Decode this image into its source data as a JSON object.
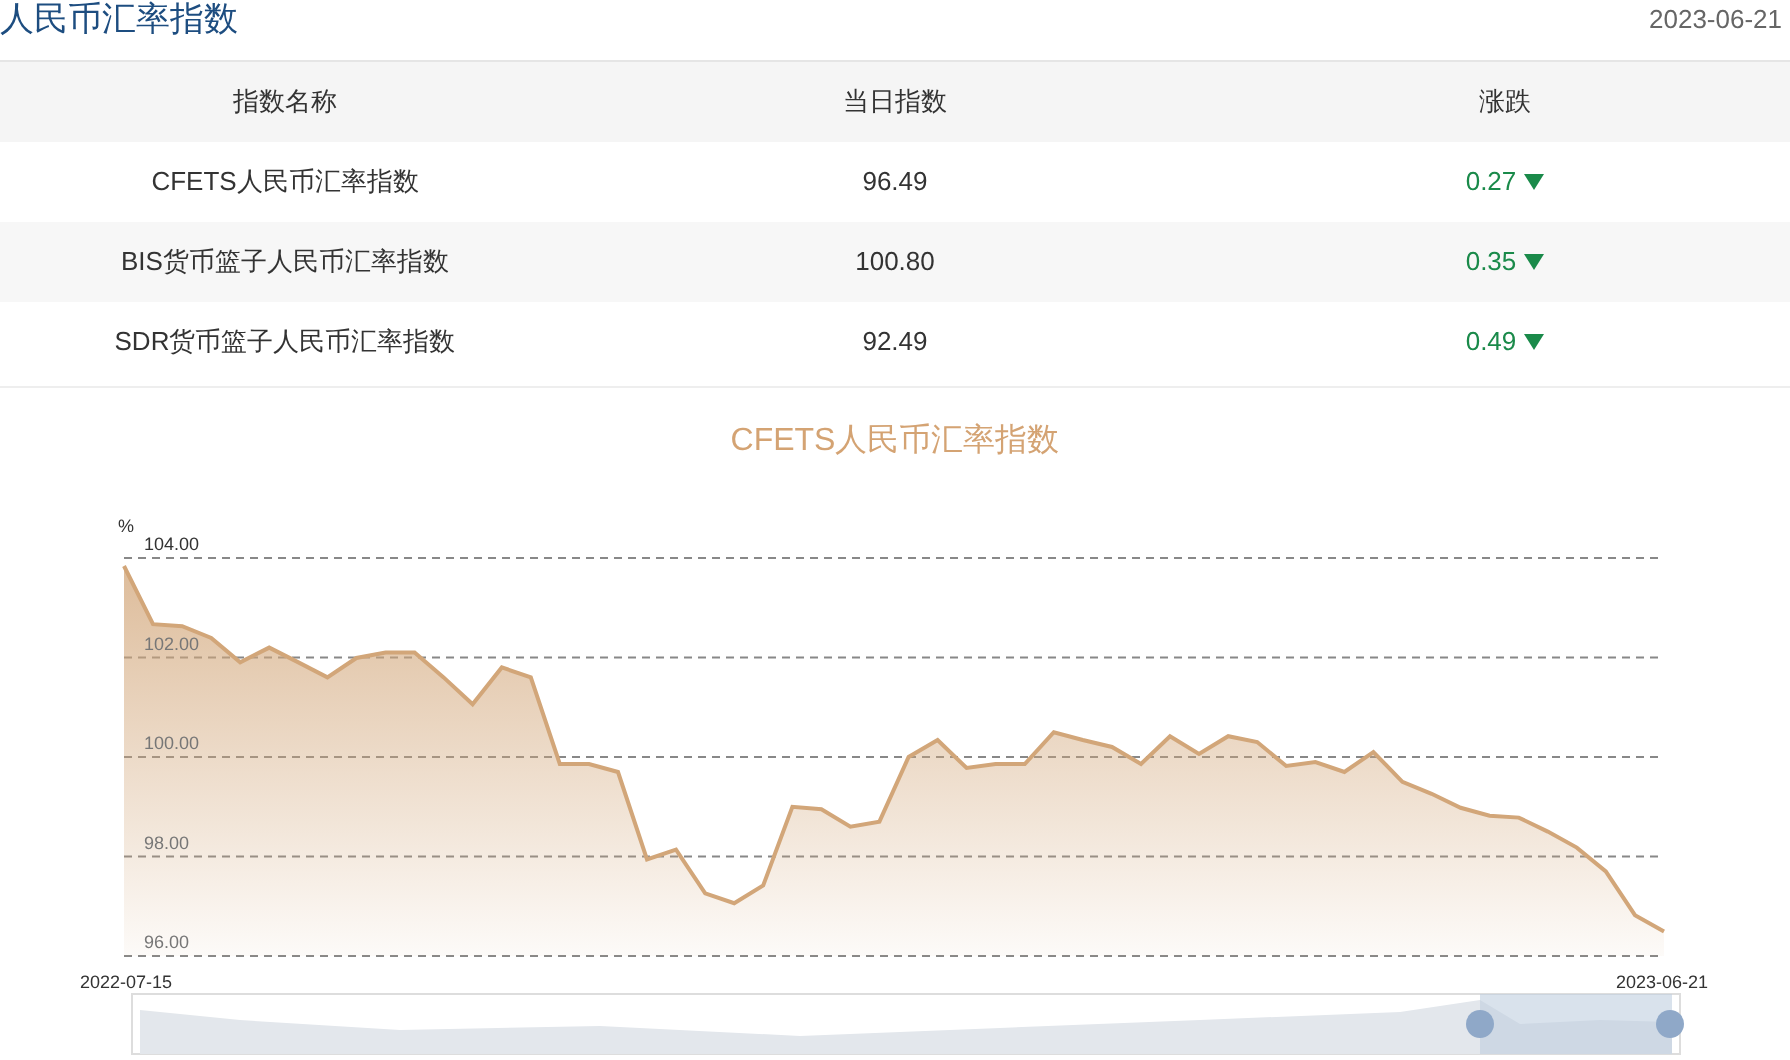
{
  "header": {
    "title": "人民币汇率指数",
    "date": "2023-06-21"
  },
  "table": {
    "columns": [
      "指数名称",
      "当日指数",
      "涨跌"
    ],
    "rows": [
      {
        "name": "CFETS人民币汇率指数",
        "value": "96.49",
        "change": "0.27",
        "kind": "down"
      },
      {
        "name": "BIS货币篮子人民币汇率指数",
        "value": "100.80",
        "change": "0.35",
        "kind": "down"
      },
      {
        "name": "SDR货币篮子人民币汇率指数",
        "value": "92.49",
        "change": "0.49",
        "kind": "down"
      }
    ]
  },
  "chart": {
    "range_start": "2022-07-15",
    "range_end": "2023-06-21",
    "chart_data": {
      "type": "area",
      "grid": true,
      "title": "CFETS人民币汇率指数",
      "ylabel": "%",
      "ylim": [
        96,
        104
      ],
      "yticks": [
        {
          "value": 96,
          "label": "96.00"
        },
        {
          "value": 98,
          "label": "98.00"
        },
        {
          "value": 100,
          "label": "100.00"
        },
        {
          "value": 102,
          "label": "102.00"
        },
        {
          "value": 104,
          "label": "104.00"
        }
      ],
      "series": [
        {
          "color": "#d2a679",
          "values": [
            103.84,
            102.67,
            102.63,
            102.39,
            101.9,
            102.2,
            101.9,
            101.6,
            101.99,
            102.1,
            102.1,
            101.6,
            101.06,
            101.8,
            101.6,
            99.86,
            99.86,
            99.7,
            97.94,
            98.14,
            97.26,
            97.06,
            97.42,
            99.0,
            98.95,
            98.6,
            98.7,
            100.0,
            100.34,
            99.78,
            99.86,
            99.86,
            100.5,
            100.34,
            100.2,
            99.86,
            100.42,
            100.06,
            100.42,
            100.3,
            99.82,
            99.9,
            99.7,
            100.1,
            99.5,
            99.26,
            98.98,
            98.82,
            98.78,
            98.5,
            98.18,
            97.7,
            96.82,
            96.49
          ]
        }
      ]
    }
  }
}
